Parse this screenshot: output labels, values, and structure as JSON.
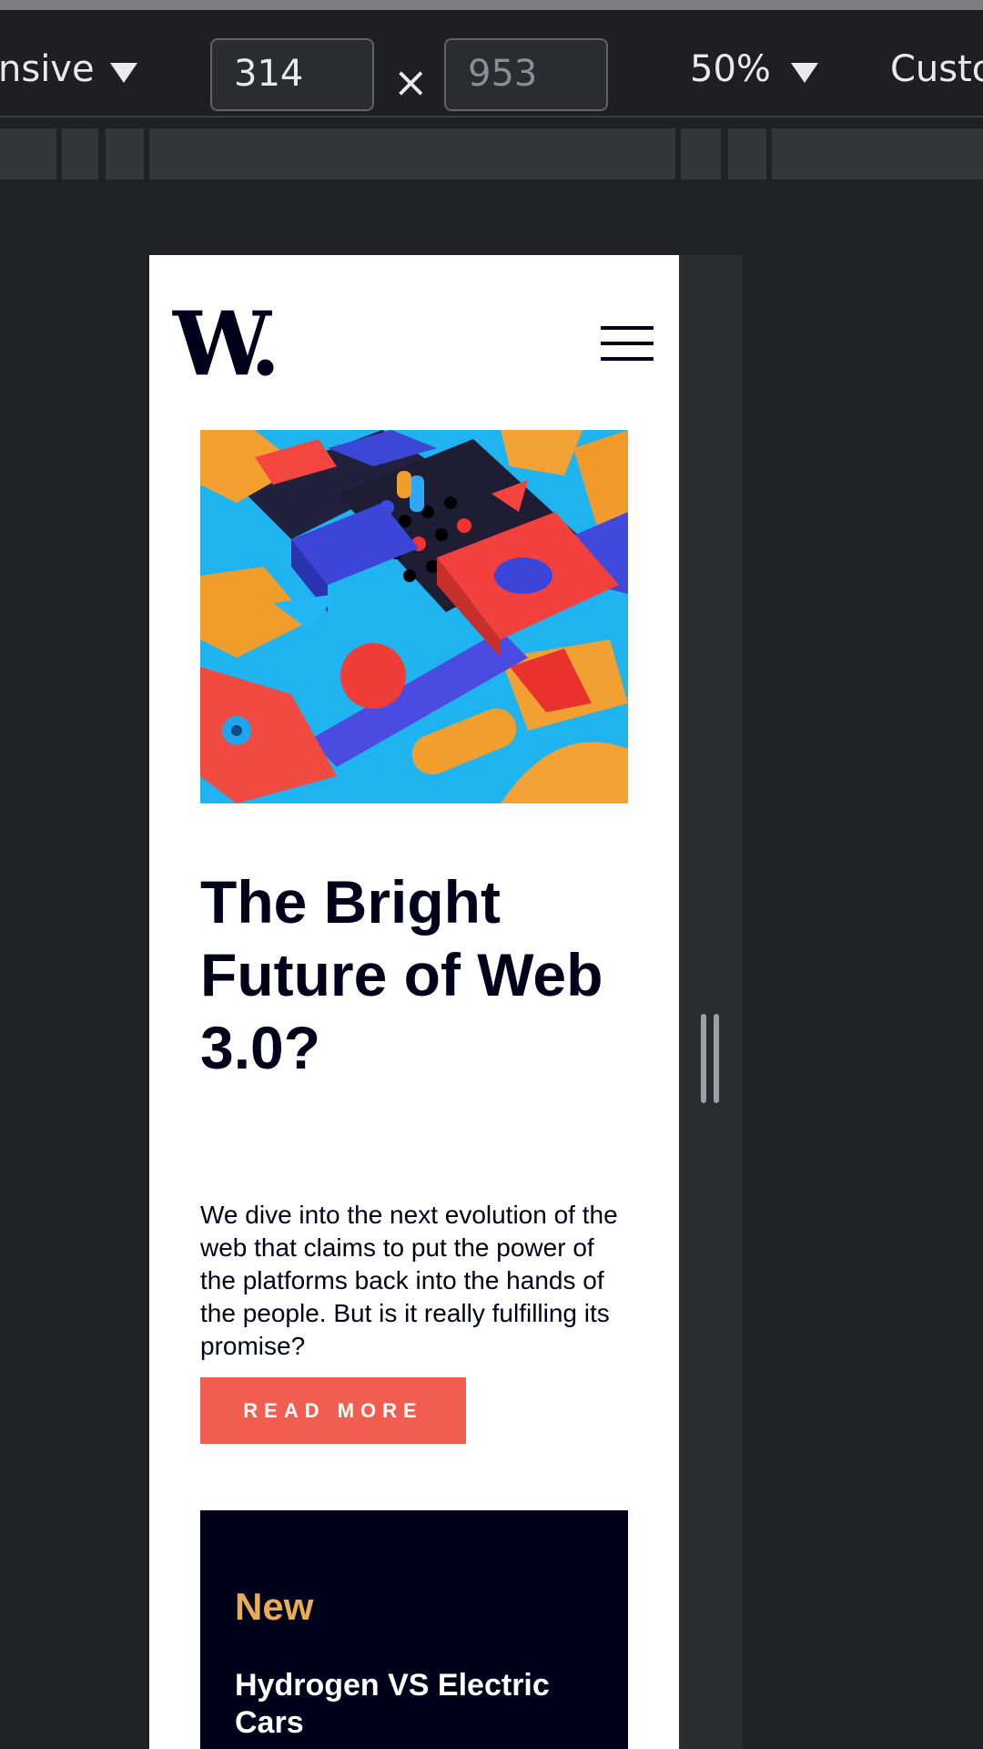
{
  "devtools": {
    "device_label": "nsive",
    "width_value": "314",
    "height_placeholder": "953",
    "times_sign": "×",
    "zoom": "50%",
    "throttle_label": "Custo"
  },
  "site": {
    "logo": "W.",
    "hero": {
      "title": "The Bright Future of Web 3.0?",
      "description": "We dive into the next evolution of the web that claims to put the power of the platforms back into the hands of the people. But is it really fulfilling its promise?",
      "cta": "READ MORE"
    },
    "new_section": {
      "heading": "New",
      "items": [
        {
          "title": "Hydrogen VS Electric Cars"
        }
      ]
    }
  },
  "colors": {
    "accent": "#f15e50",
    "navy": "#00001a",
    "gold": "#e9ab53"
  }
}
